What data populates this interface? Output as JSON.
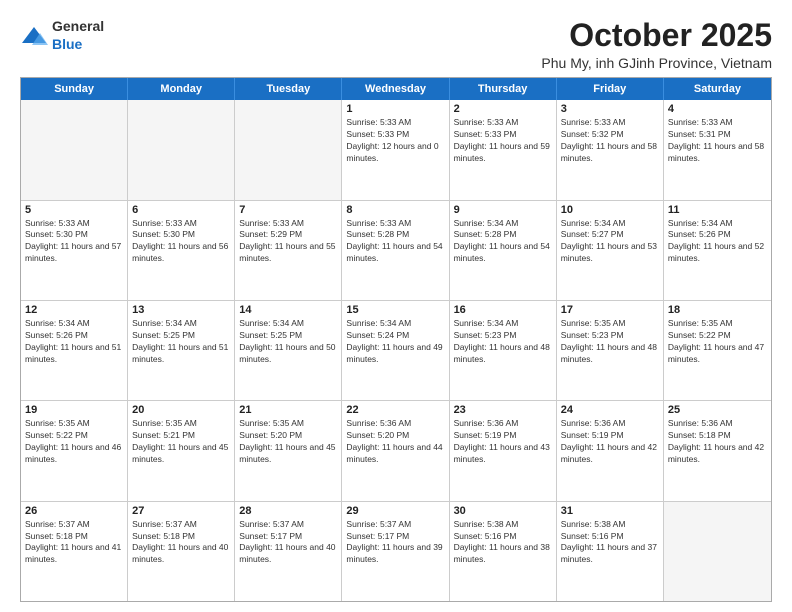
{
  "header": {
    "logo": {
      "text_general": "General",
      "text_blue": "Blue"
    },
    "month_title": "October 2025",
    "location": "Phu My, inh GJinh Province, Vietnam"
  },
  "calendar": {
    "days_of_week": [
      "Sunday",
      "Monday",
      "Tuesday",
      "Wednesday",
      "Thursday",
      "Friday",
      "Saturday"
    ],
    "weeks": [
      [
        {
          "day": "",
          "empty": true
        },
        {
          "day": "",
          "empty": true
        },
        {
          "day": "",
          "empty": true
        },
        {
          "day": "1",
          "sunrise": "5:33 AM",
          "sunset": "5:33 PM",
          "daylight": "12 hours and 0 minutes."
        },
        {
          "day": "2",
          "sunrise": "5:33 AM",
          "sunset": "5:33 PM",
          "daylight": "11 hours and 59 minutes."
        },
        {
          "day": "3",
          "sunrise": "5:33 AM",
          "sunset": "5:32 PM",
          "daylight": "11 hours and 58 minutes."
        },
        {
          "day": "4",
          "sunrise": "5:33 AM",
          "sunset": "5:31 PM",
          "daylight": "11 hours and 58 minutes."
        }
      ],
      [
        {
          "day": "5",
          "sunrise": "5:33 AM",
          "sunset": "5:30 PM",
          "daylight": "11 hours and 57 minutes."
        },
        {
          "day": "6",
          "sunrise": "5:33 AM",
          "sunset": "5:30 PM",
          "daylight": "11 hours and 56 minutes."
        },
        {
          "day": "7",
          "sunrise": "5:33 AM",
          "sunset": "5:29 PM",
          "daylight": "11 hours and 55 minutes."
        },
        {
          "day": "8",
          "sunrise": "5:33 AM",
          "sunset": "5:28 PM",
          "daylight": "11 hours and 54 minutes."
        },
        {
          "day": "9",
          "sunrise": "5:34 AM",
          "sunset": "5:28 PM",
          "daylight": "11 hours and 54 minutes."
        },
        {
          "day": "10",
          "sunrise": "5:34 AM",
          "sunset": "5:27 PM",
          "daylight": "11 hours and 53 minutes."
        },
        {
          "day": "11",
          "sunrise": "5:34 AM",
          "sunset": "5:26 PM",
          "daylight": "11 hours and 52 minutes."
        }
      ],
      [
        {
          "day": "12",
          "sunrise": "5:34 AM",
          "sunset": "5:26 PM",
          "daylight": "11 hours and 51 minutes."
        },
        {
          "day": "13",
          "sunrise": "5:34 AM",
          "sunset": "5:25 PM",
          "daylight": "11 hours and 51 minutes."
        },
        {
          "day": "14",
          "sunrise": "5:34 AM",
          "sunset": "5:25 PM",
          "daylight": "11 hours and 50 minutes."
        },
        {
          "day": "15",
          "sunrise": "5:34 AM",
          "sunset": "5:24 PM",
          "daylight": "11 hours and 49 minutes."
        },
        {
          "day": "16",
          "sunrise": "5:34 AM",
          "sunset": "5:23 PM",
          "daylight": "11 hours and 48 minutes."
        },
        {
          "day": "17",
          "sunrise": "5:35 AM",
          "sunset": "5:23 PM",
          "daylight": "11 hours and 48 minutes."
        },
        {
          "day": "18",
          "sunrise": "5:35 AM",
          "sunset": "5:22 PM",
          "daylight": "11 hours and 47 minutes."
        }
      ],
      [
        {
          "day": "19",
          "sunrise": "5:35 AM",
          "sunset": "5:22 PM",
          "daylight": "11 hours and 46 minutes."
        },
        {
          "day": "20",
          "sunrise": "5:35 AM",
          "sunset": "5:21 PM",
          "daylight": "11 hours and 45 minutes."
        },
        {
          "day": "21",
          "sunrise": "5:35 AM",
          "sunset": "5:20 PM",
          "daylight": "11 hours and 45 minutes."
        },
        {
          "day": "22",
          "sunrise": "5:36 AM",
          "sunset": "5:20 PM",
          "daylight": "11 hours and 44 minutes."
        },
        {
          "day": "23",
          "sunrise": "5:36 AM",
          "sunset": "5:19 PM",
          "daylight": "11 hours and 43 minutes."
        },
        {
          "day": "24",
          "sunrise": "5:36 AM",
          "sunset": "5:19 PM",
          "daylight": "11 hours and 42 minutes."
        },
        {
          "day": "25",
          "sunrise": "5:36 AM",
          "sunset": "5:18 PM",
          "daylight": "11 hours and 42 minutes."
        }
      ],
      [
        {
          "day": "26",
          "sunrise": "5:37 AM",
          "sunset": "5:18 PM",
          "daylight": "11 hours and 41 minutes."
        },
        {
          "day": "27",
          "sunrise": "5:37 AM",
          "sunset": "5:18 PM",
          "daylight": "11 hours and 40 minutes."
        },
        {
          "day": "28",
          "sunrise": "5:37 AM",
          "sunset": "5:17 PM",
          "daylight": "11 hours and 40 minutes."
        },
        {
          "day": "29",
          "sunrise": "5:37 AM",
          "sunset": "5:17 PM",
          "daylight": "11 hours and 39 minutes."
        },
        {
          "day": "30",
          "sunrise": "5:38 AM",
          "sunset": "5:16 PM",
          "daylight": "11 hours and 38 minutes."
        },
        {
          "day": "31",
          "sunrise": "5:38 AM",
          "sunset": "5:16 PM",
          "daylight": "11 hours and 37 minutes."
        },
        {
          "day": "",
          "empty": true
        }
      ]
    ]
  }
}
